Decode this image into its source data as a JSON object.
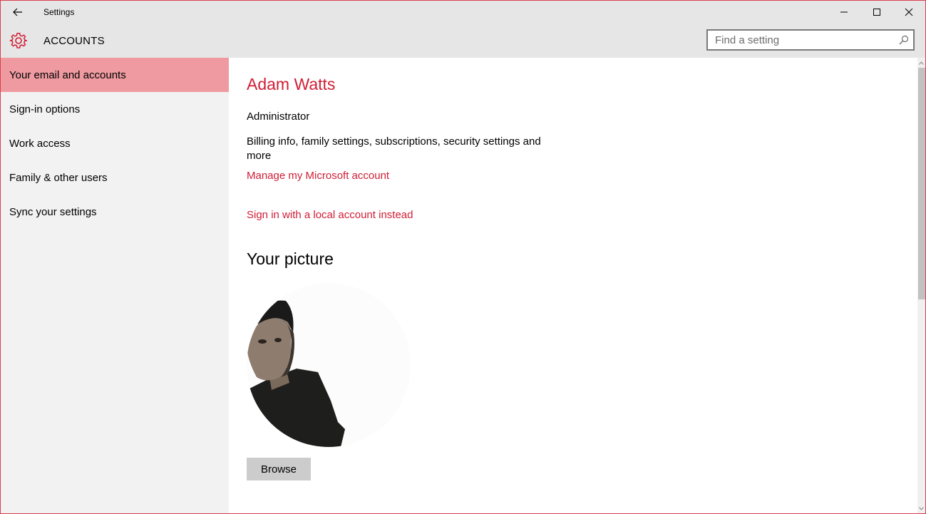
{
  "window": {
    "title": "Settings"
  },
  "header": {
    "section_title": "ACCOUNTS",
    "search_placeholder": "Find a setting",
    "search_value": ""
  },
  "sidebar": {
    "items": [
      {
        "label": "Your email and accounts",
        "selected": true
      },
      {
        "label": "Sign-in options",
        "selected": false
      },
      {
        "label": "Work access",
        "selected": false
      },
      {
        "label": "Family & other users",
        "selected": false
      },
      {
        "label": "Sync your settings",
        "selected": false
      }
    ]
  },
  "main": {
    "user_name": "Adam Watts",
    "role": "Administrator",
    "description": "Billing info, family settings, subscriptions, security settings and more",
    "manage_link": "Manage my Microsoft account",
    "local_account_link": "Sign in with a local account instead",
    "picture_heading": "Your picture",
    "browse_label": "Browse"
  },
  "icons": {
    "back": "back-arrow-icon",
    "settings": "gear-icon",
    "search": "search-icon",
    "minimize": "minimize-icon",
    "maximize": "maximize-icon",
    "close": "close-icon"
  },
  "colors": {
    "accent": "#d01e35",
    "selected_nav": "#ee9aa0",
    "chrome": "#e6e6e6",
    "sidebar": "#f2f2f2",
    "button": "#cccccc"
  }
}
